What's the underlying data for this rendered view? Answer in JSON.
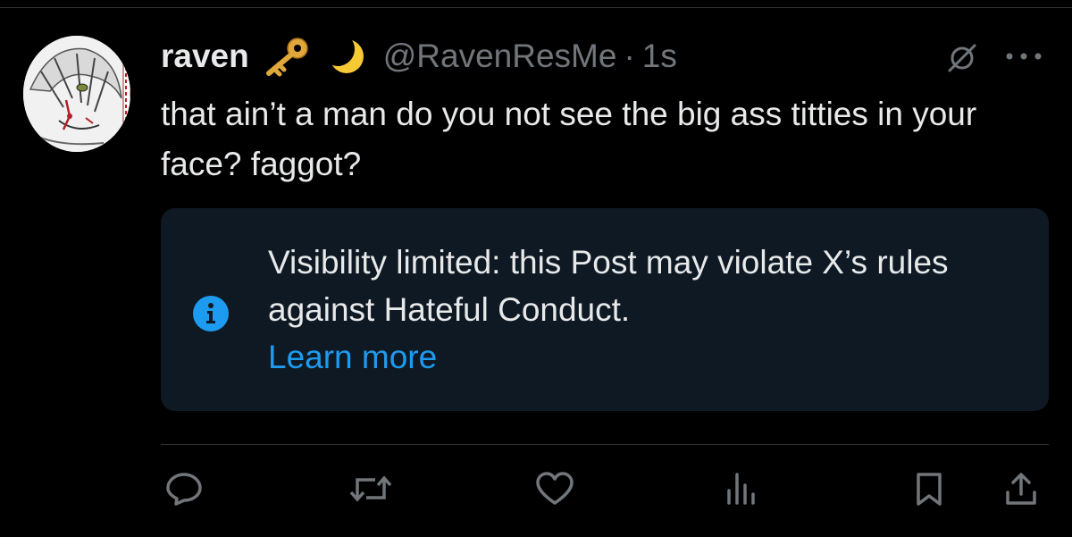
{
  "post": {
    "author_name": "raven",
    "author_emojis": [
      "key-emoji",
      "crescent-moon-emoji"
    ],
    "handle": "@RavenResMe",
    "separator": "·",
    "time": "1s",
    "text": "that ain’t a man do you not see the big ass titties in your face? faggot?"
  },
  "notice": {
    "message": "Visibility limited: this Post may violate X’s rules against Hateful Conduct.",
    "link_label": "Learn more",
    "icon": "info-icon"
  },
  "actions": [
    "reply-icon",
    "repost-icon",
    "like-icon",
    "views-icon",
    "bookmark-icon",
    "share-icon"
  ],
  "colors": {
    "background": "#000000",
    "text": "#e7e9ea",
    "secondary": "#71767b",
    "accent": "#1d9bf0",
    "notice_bg": "#0f1923",
    "divider": "#2f3336"
  }
}
